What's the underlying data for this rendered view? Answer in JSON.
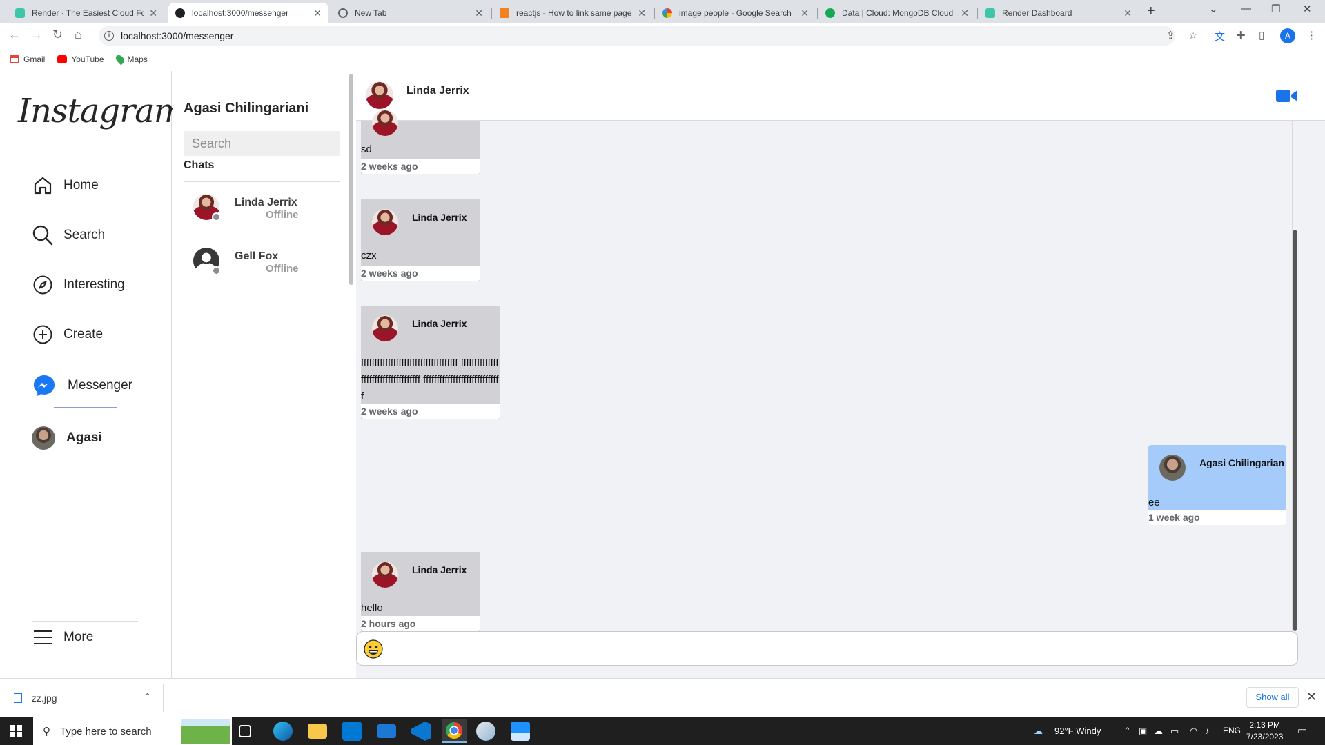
{
  "browser": {
    "tabs": [
      {
        "title": "Render · The Easiest Cloud For A",
        "favicon_color": "#3ec6a9",
        "active": false
      },
      {
        "title": "localhost:3000/messenger",
        "favicon_color": "#202124",
        "active": true
      },
      {
        "title": "New Tab",
        "favicon_color": "#5f6368",
        "active": false
      },
      {
        "title": "reactjs - How to link same page",
        "favicon_color": "#f48024",
        "active": false
      },
      {
        "title": "image people - Google Search",
        "favicon_color": "#4285f4",
        "active": false
      },
      {
        "title": "Data | Cloud: MongoDB Cloud",
        "favicon_color": "#13aa52",
        "active": false
      },
      {
        "title": "Render Dashboard",
        "favicon_color": "#3ec6a9",
        "active": false
      }
    ],
    "url": "localhost:3000/messenger",
    "profile_initial": "A",
    "bookmarks": [
      {
        "label": "Gmail",
        "icon": "gmail-icon",
        "color": "#ea4335"
      },
      {
        "label": "YouTube",
        "icon": "youtube-icon",
        "color": "#ff0000"
      },
      {
        "label": "Maps",
        "icon": "maps-icon",
        "color": "#34a853"
      }
    ]
  },
  "app": {
    "logo": "Instagram",
    "nav": [
      {
        "label": "Home",
        "icon": "home-icon"
      },
      {
        "label": "Search",
        "icon": "search-icon"
      },
      {
        "label": "Interesting",
        "icon": "compass-icon"
      },
      {
        "label": "Create",
        "icon": "plus-circle-icon"
      },
      {
        "label": "Messenger",
        "icon": "messenger-icon"
      },
      {
        "label": "Agasi",
        "icon": "avatar"
      }
    ],
    "more_label": "More"
  },
  "chatlist": {
    "username": "Agasi Chilingariani",
    "search_placeholder": "Search",
    "section_label": "Chats",
    "contacts": [
      {
        "name": "Linda  Jerrix",
        "status": "Offline"
      },
      {
        "name": "Gell  Fox",
        "status": "Offline"
      }
    ]
  },
  "conversation": {
    "header_name": "Linda  Jerrix",
    "accent_color": "#1a73e8",
    "messages": [
      {
        "sender": "Linda  Jerrix",
        "text": "sd",
        "time": "2 weeks ago",
        "own": false
      },
      {
        "sender": "Linda  Jerrix",
        "text": "czx",
        "time": "2 weeks ago",
        "own": false
      },
      {
        "sender": "Linda  Jerrix",
        "text": "ffffffffffffffffffffffffffffffffffff ffffffffffffffffffffffffffffffffffff fffffffffffffffffffffffffffff",
        "time": "2 weeks ago",
        "own": false
      },
      {
        "sender": "Agasi  Chilingarian",
        "text": "ee",
        "time": "1 week ago",
        "own": true
      },
      {
        "sender": "Linda  Jerrix",
        "text": "hello",
        "time": "2 hours ago",
        "own": false
      }
    ]
  },
  "downloads": {
    "file": "zz.jpg",
    "show_all": "Show all"
  },
  "taskbar": {
    "search_placeholder": "Type here to search",
    "weather": "92°F  Windy",
    "language": "ENG",
    "time": "2:13 PM",
    "date": "7/23/2023"
  }
}
